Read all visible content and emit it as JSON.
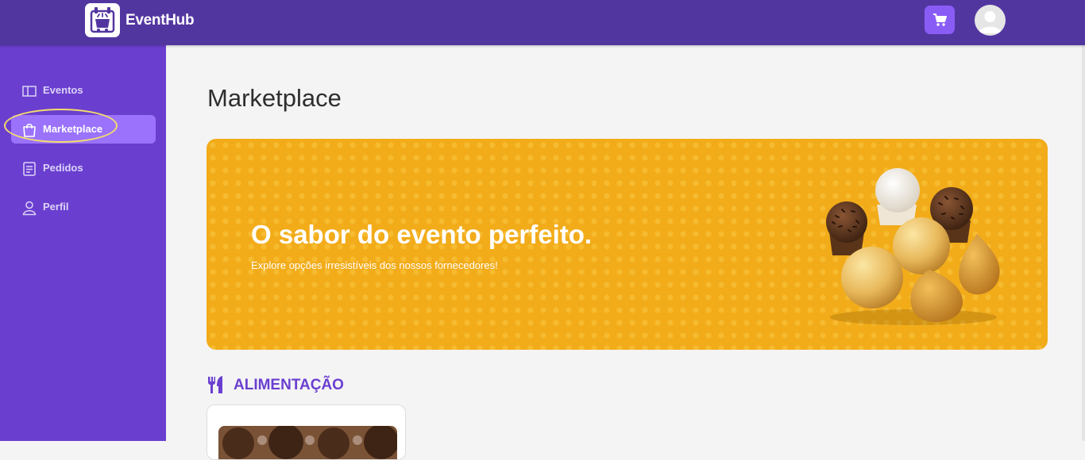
{
  "app": {
    "brand": "EventHub"
  },
  "header": {
    "cart_icon": "cart-icon",
    "avatar_icon": "user-avatar-icon"
  },
  "sidebar": {
    "items": [
      {
        "label": "Eventos",
        "icon": "ticket-icon",
        "active": false
      },
      {
        "label": "Marketplace",
        "icon": "shopping-bag-icon",
        "active": true
      },
      {
        "label": "Pedidos",
        "icon": "receipt-icon",
        "active": false
      },
      {
        "label": "Perfil",
        "icon": "user-icon",
        "active": false
      }
    ]
  },
  "main": {
    "title": "Marketplace",
    "banner": {
      "title": "O sabor do evento perfeito.",
      "subtitle": "Explore opções irresistíveis dos nossos fornecedores!"
    },
    "section": {
      "title": "ALIMENTAÇÃO",
      "icon": "utensils-icon"
    }
  },
  "colors": {
    "topbar": "#5236a0",
    "sidebar": "#6a3fd0",
    "active_item": "#9a72fb",
    "accent": "#8a5cf6",
    "banner": "#f2ac1a",
    "section_title": "#6a3fd0"
  }
}
